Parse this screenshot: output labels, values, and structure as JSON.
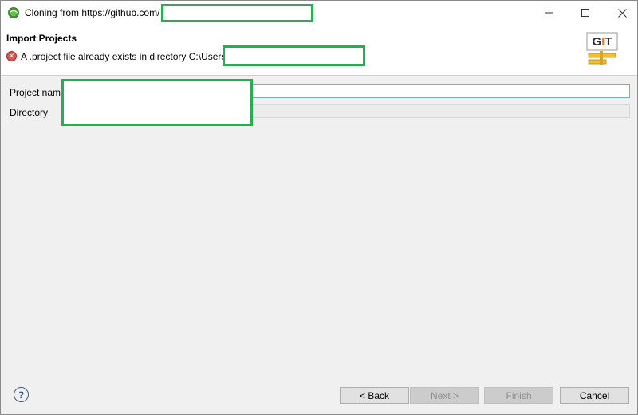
{
  "window": {
    "title": "Cloning from https://github.com/"
  },
  "header": {
    "title": "Import Projects",
    "error_message": "A .project file already exists in directory C:\\Users",
    "logo_text": "GIT"
  },
  "form": {
    "project_name_label": "Project name",
    "directory_label": "Directory"
  },
  "footer": {
    "back_label": "< Back",
    "next_label": "Next >",
    "finish_label": "Finish",
    "cancel_label": "Cancel"
  },
  "colors": {
    "redaction_border": "#22b14c",
    "error_red": "#d9534f",
    "focus_border": "#7aa7d6"
  },
  "icons": {
    "app": "eclipse-icon",
    "error": "error-icon",
    "help": "help-icon",
    "logo": "git-logo"
  }
}
